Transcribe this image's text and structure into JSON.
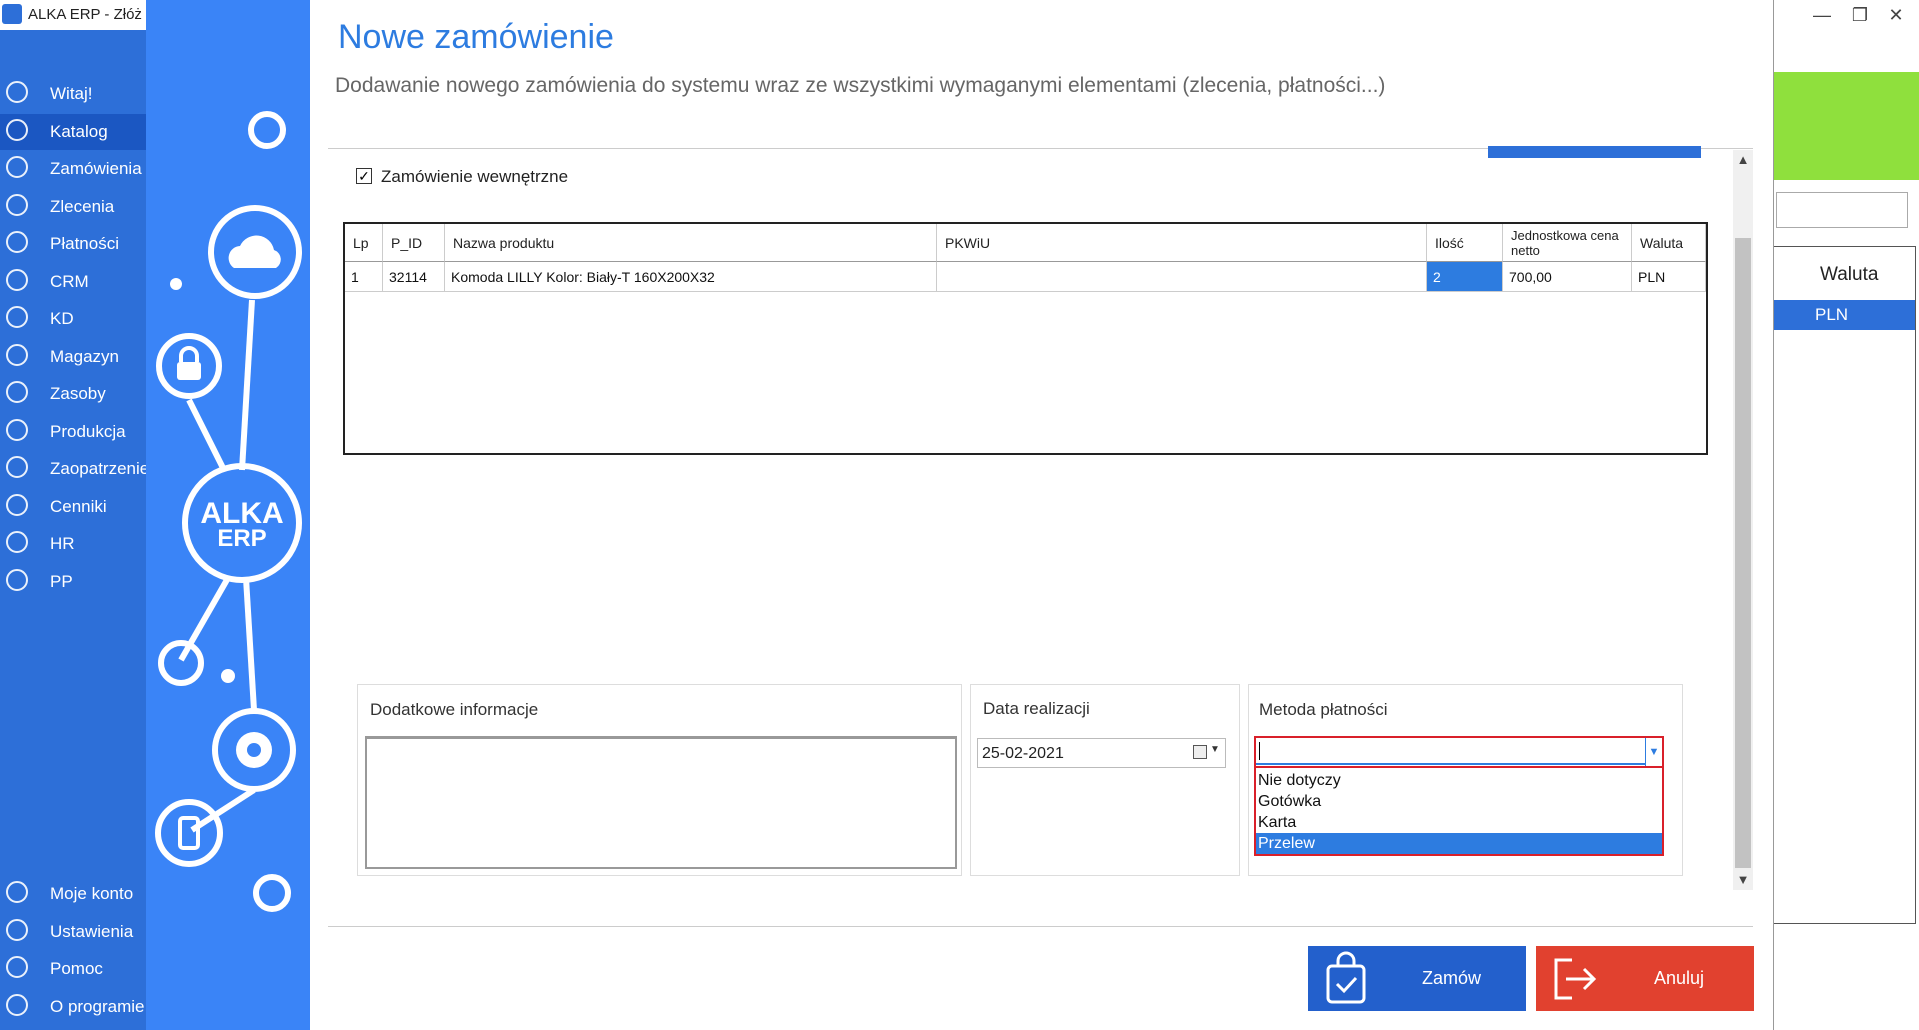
{
  "window": {
    "title": "ALKA ERP - Złóż z",
    "minimize": "—",
    "restore": "❐",
    "close": "✕"
  },
  "sidebar": {
    "items": [
      {
        "label": "Witaj!",
        "icon": "home-icon"
      },
      {
        "label": "Katalog",
        "icon": "book-icon",
        "active": true
      },
      {
        "label": "Zamówienia",
        "icon": "cart-icon"
      },
      {
        "label": "Zlecenia",
        "icon": "list-icon"
      },
      {
        "label": "Płatności",
        "icon": "dollar-icon"
      },
      {
        "label": "CRM",
        "icon": "crm-icon"
      },
      {
        "label": "KD",
        "icon": "user-icon"
      },
      {
        "label": "Magazyn",
        "icon": "warehouse-icon"
      },
      {
        "label": "Zasoby",
        "icon": "resources-icon"
      },
      {
        "label": "Produkcja",
        "icon": "production-icon"
      },
      {
        "label": "Zaopatrzenie",
        "icon": "truck-icon"
      },
      {
        "label": "Cenniki",
        "icon": "tag-icon"
      },
      {
        "label": "HR",
        "icon": "hr-icon"
      },
      {
        "label": "PP",
        "icon": "pp-icon"
      }
    ],
    "bottom_items": [
      {
        "label": "Moje konto",
        "icon": "account-icon"
      },
      {
        "label": "Ustawienia",
        "icon": "settings-icon"
      },
      {
        "label": "Pomoc",
        "icon": "help-icon"
      },
      {
        "label": "O programie",
        "icon": "info-icon"
      }
    ]
  },
  "background": {
    "column_header": "Waluta",
    "cell_value": "PLN"
  },
  "branding": {
    "logo_line1": "ALKA",
    "logo_line2": "ERP"
  },
  "dialog": {
    "title": "Nowe zamówienie",
    "subtitle": "Dodawanie nowego zamówienia do systemu wraz ze wszystkimi wymaganymi elementami (zlecenia, płatności...)",
    "internal_order_label": "Zamówienie wewnętrzne",
    "internal_order_checked": true,
    "grid": {
      "headers": [
        "Lp",
        "P_ID",
        "Nazwa produktu",
        "PKWiU",
        "Ilość",
        "Jednostkowa cena netto",
        "Waluta"
      ],
      "rows": [
        [
          "1",
          "32114",
          "Komoda LILLY Kolor: Biały-T 160X200X32",
          "",
          "2",
          "700,00",
          "PLN"
        ]
      ]
    },
    "notes": {
      "title": "Dodatkowe informacje",
      "value": ""
    },
    "date": {
      "title": "Data realizacji",
      "value": "25-02-2021"
    },
    "payment": {
      "title": "Metoda płatności",
      "value": "",
      "options": [
        "Nie dotyczy",
        "Gotówka",
        "Karta",
        "Przelew"
      ],
      "highlighted": "Przelew"
    },
    "buttons": {
      "order": "Zamów",
      "cancel": "Anuluj"
    }
  },
  "colors": {
    "sidebar_bg": "#2d6fd8",
    "title_blue": "#2d7ce0",
    "order_button": "#2360cc",
    "cancel_button": "#e1412f",
    "highlight_red": "#d9202a",
    "accent_green": "#8fe03d"
  }
}
